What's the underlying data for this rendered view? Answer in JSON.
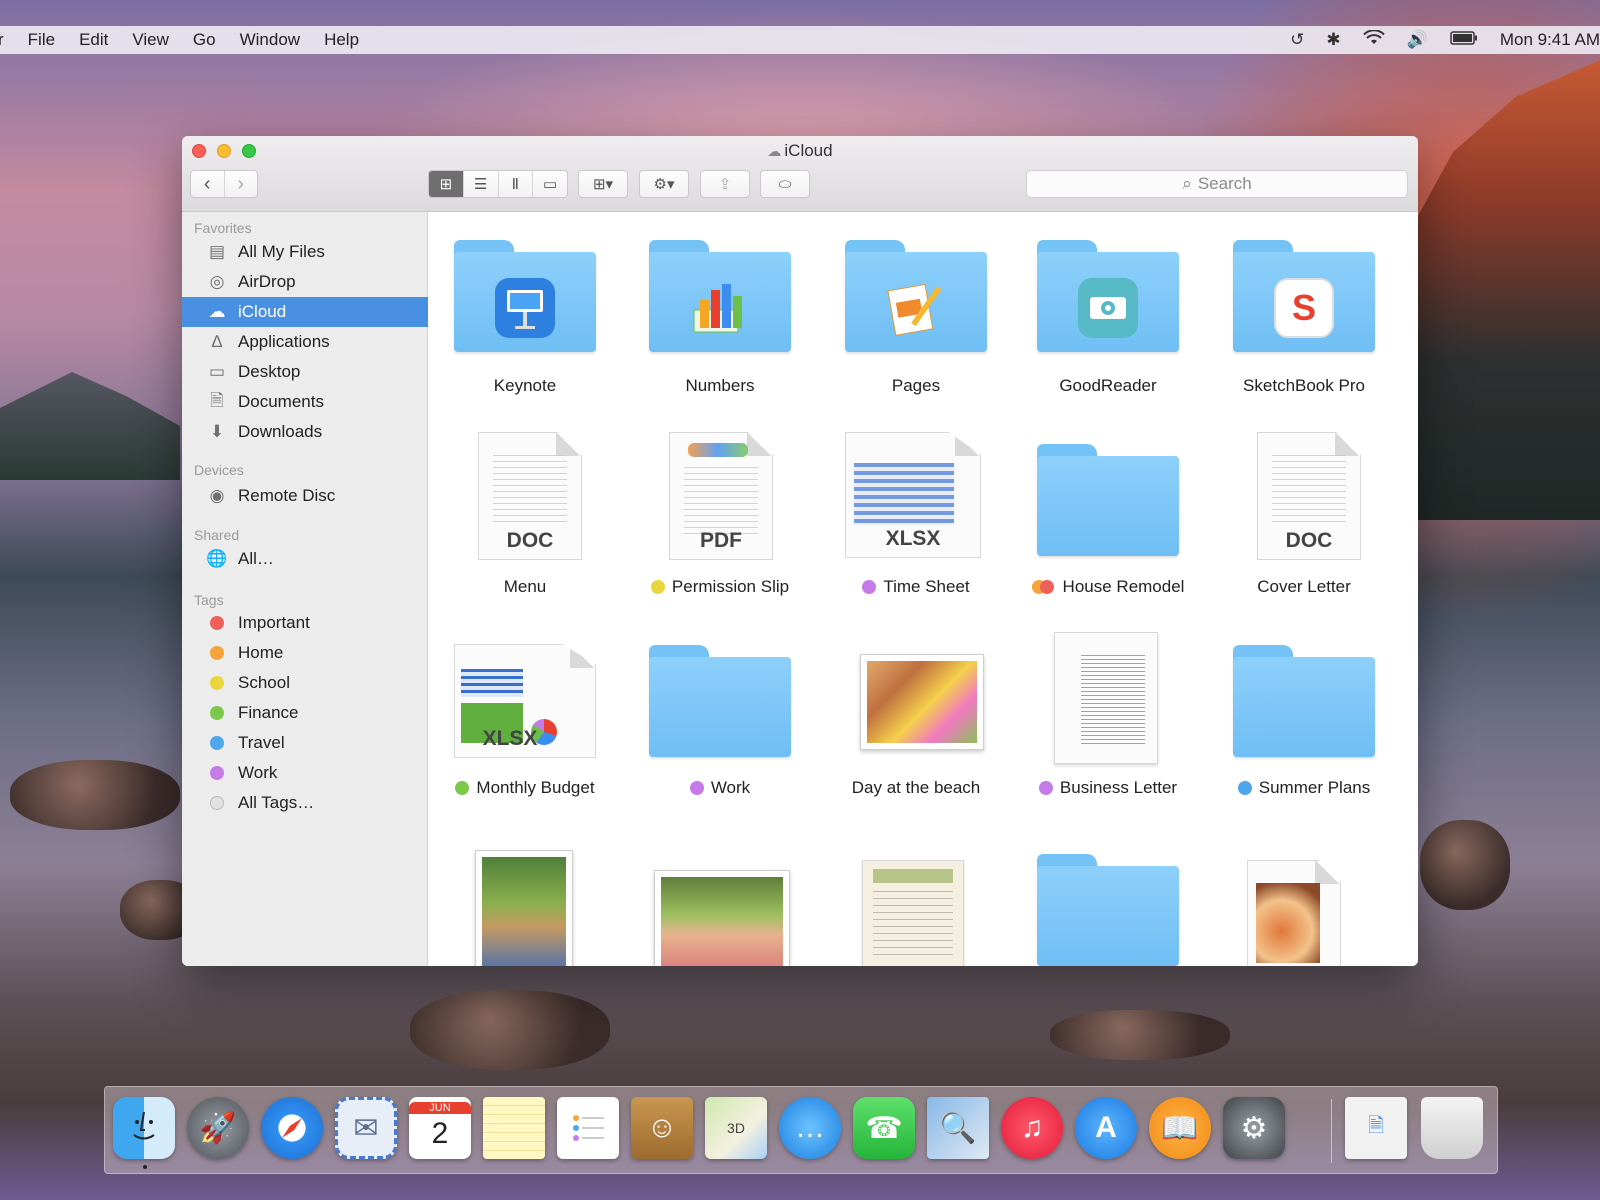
{
  "menubar": {
    "items": [
      "File",
      "Edit",
      "View",
      "Go",
      "Window",
      "Help"
    ],
    "clock": "Mon 9:41 AM",
    "status_icons": [
      "time-machine-icon",
      "bluetooth-icon",
      "wifi-icon",
      "volume-icon",
      "battery-icon"
    ]
  },
  "window": {
    "title": "iCloud",
    "search_placeholder": "Search"
  },
  "sidebar": {
    "favorites_header": "Favorites",
    "favorites": [
      {
        "label": "All My Files",
        "icon": "all-files-icon"
      },
      {
        "label": "AirDrop",
        "icon": "airdrop-icon"
      },
      {
        "label": "iCloud",
        "icon": "cloud-icon",
        "selected": true
      },
      {
        "label": "Applications",
        "icon": "applications-icon"
      },
      {
        "label": "Desktop",
        "icon": "desktop-icon"
      },
      {
        "label": "Documents",
        "icon": "documents-icon"
      },
      {
        "label": "Downloads",
        "icon": "downloads-icon"
      }
    ],
    "devices_header": "Devices",
    "devices": [
      {
        "label": "Remote Disc",
        "icon": "disc-icon"
      }
    ],
    "shared_header": "Shared",
    "shared": [
      {
        "label": "All…",
        "icon": "network-icon"
      }
    ],
    "tags_header": "Tags",
    "tags": [
      {
        "label": "Important",
        "color": "#f0605b"
      },
      {
        "label": "Home",
        "color": "#f5a33a"
      },
      {
        "label": "School",
        "color": "#e9d63c"
      },
      {
        "label": "Finance",
        "color": "#7bc94a"
      },
      {
        "label": "Travel",
        "color": "#4ea6ec"
      },
      {
        "label": "Work",
        "color": "#c47be7"
      },
      {
        "label": "All Tags…",
        "color": "#e2e2e2"
      }
    ]
  },
  "content": {
    "items": [
      {
        "name": "Keynote",
        "kind": "folder",
        "emblem": "keynote-icon",
        "tags": []
      },
      {
        "name": "Numbers",
        "kind": "folder",
        "emblem": "numbers-icon",
        "tags": []
      },
      {
        "name": "Pages",
        "kind": "folder",
        "emblem": "pages-icon",
        "tags": []
      },
      {
        "name": "GoodReader",
        "kind": "folder",
        "emblem": "goodreader-icon",
        "tags": []
      },
      {
        "name": "SketchBook Pro",
        "kind": "folder",
        "emblem": "sketchbook-icon",
        "tags": []
      },
      {
        "name": "Menu",
        "kind": "document",
        "ext": "DOC",
        "tags": []
      },
      {
        "name": "Permission Slip",
        "kind": "document",
        "ext": "PDF",
        "tags": [
          "#e9d63c"
        ]
      },
      {
        "name": "Time Sheet",
        "kind": "document",
        "ext": "XLSX",
        "tags": [
          "#c47be7"
        ]
      },
      {
        "name": "House Remodel",
        "kind": "folder",
        "tags": [
          "#f5a33a",
          "#f0605b"
        ]
      },
      {
        "name": "Cover Letter",
        "kind": "document",
        "ext": "DOC",
        "tags": []
      },
      {
        "name": "Monthly Budget",
        "kind": "document",
        "ext": "XLSX",
        "tags": [
          "#7bc94a"
        ]
      },
      {
        "name": "Work",
        "kind": "folder",
        "tags": [
          "#c47be7"
        ]
      },
      {
        "name": "Day at the beach",
        "kind": "photo",
        "tags": []
      },
      {
        "name": "Business Letter",
        "kind": "document",
        "tags": [
          "#c47be7"
        ]
      },
      {
        "name": "Summer Plans",
        "kind": "folder",
        "tags": [
          "#4ea6ec"
        ]
      }
    ]
  },
  "dock": {
    "calendar_month": "JUN",
    "calendar_day": "2",
    "apps": [
      "finder-icon",
      "launchpad-icon",
      "safari-icon",
      "mail-icon",
      "calendar-icon",
      "notes-icon",
      "reminders-icon",
      "contacts-icon",
      "maps-icon",
      "messages-icon",
      "facetime-icon",
      "preview-icon",
      "itunes-icon",
      "app-store-icon",
      "ibooks-icon",
      "system-preferences-icon",
      "downloads-stack-icon",
      "trash-icon"
    ]
  }
}
